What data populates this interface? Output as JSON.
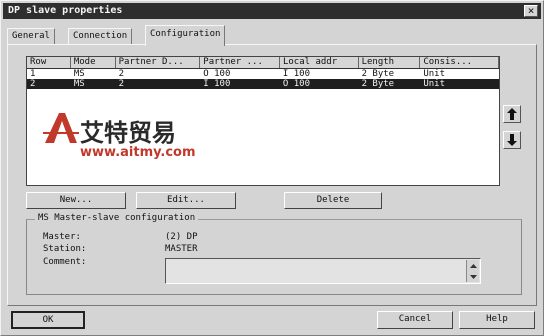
{
  "window": {
    "title": "DP slave properties",
    "close_glyph": "×"
  },
  "tabs": [
    {
      "label": "General"
    },
    {
      "label": "Connection"
    },
    {
      "label": "Configuration"
    }
  ],
  "grid": {
    "columns": [
      "Row",
      "Mode",
      "Partner D...",
      "Partner ...",
      "Local addr",
      "Length",
      "Consis..."
    ],
    "rows": [
      [
        "1",
        "MS",
        "2",
        "O 100",
        "I 100",
        "2 Byte",
        "Unit"
      ],
      [
        "2",
        "MS",
        "2",
        "I 100",
        "O 100",
        "2 Byte",
        "Unit"
      ]
    ],
    "selected_row": 2
  },
  "watermark": {
    "brand_cn": "艾特贸易",
    "url": "www.aitmy.com",
    "letter": "A"
  },
  "side_buttons": {
    "up_icon": "arrow-up-icon",
    "down_icon": "arrow-down-icon"
  },
  "actions": {
    "new_label": "New...",
    "edit_label": "Edit...",
    "delete_label": "Delete"
  },
  "ms_group": {
    "title": "MS Master-slave configuration",
    "master_label": "Master:",
    "master_value": "(2) DP",
    "station_label": "Station:",
    "station_value": "MASTER",
    "comment_label": "Comment:",
    "comment_value": ""
  },
  "footer": {
    "ok_label": "OK",
    "cancel_label": "Cancel",
    "help_label": "Help"
  },
  "colors": {
    "titlebar": "#2e2e2e",
    "selection": "#1f1f1f",
    "watermark_red": "#c0392b",
    "dialog_bg": "#d4d4d4"
  }
}
